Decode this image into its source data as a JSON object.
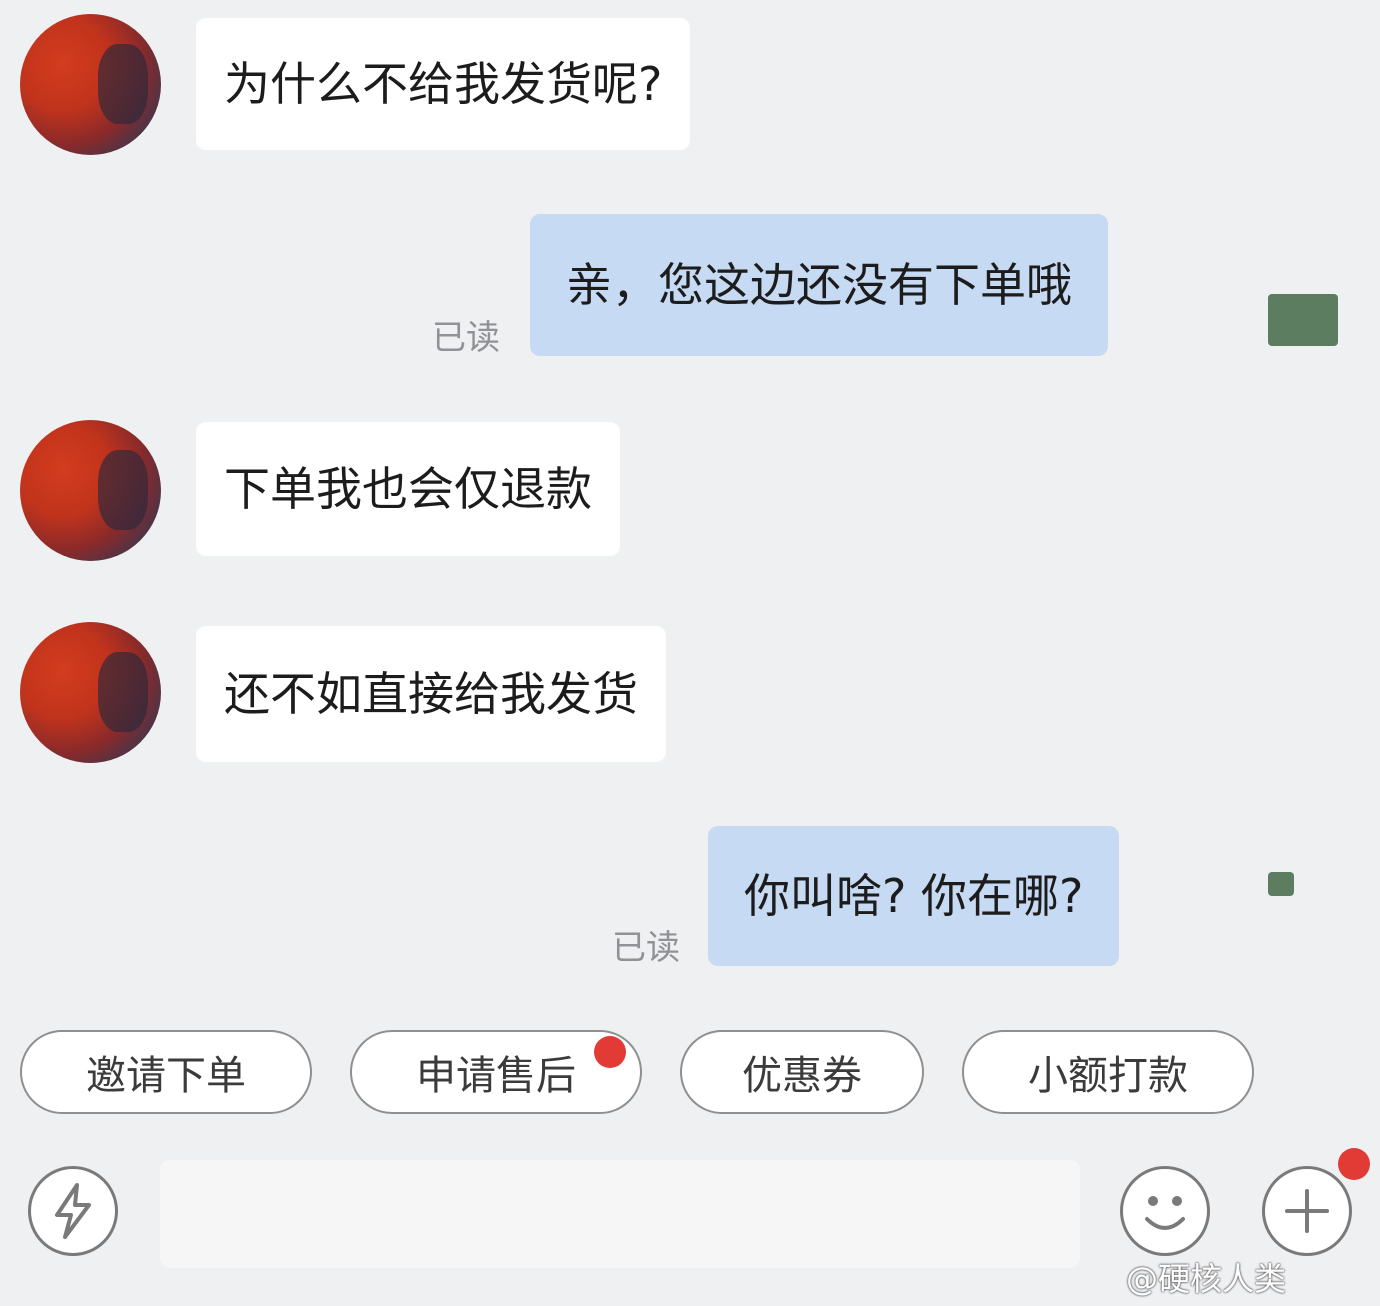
{
  "messages": {
    "m1": {
      "text": "为什么不给我发货呢?"
    },
    "m2": {
      "text": "亲，您这边还没有下单哦",
      "read": "已读"
    },
    "m3": {
      "text": "下单我也会仅退款"
    },
    "m4": {
      "text": "还不如直接给我发货"
    },
    "m5": {
      "text": "你叫啥? 你在哪?",
      "read": "已读"
    }
  },
  "quick_actions": [
    {
      "label": "邀请下单"
    },
    {
      "label": "申请售后",
      "has_badge": true
    },
    {
      "label": "优惠券"
    },
    {
      "label": "小额打款"
    }
  ],
  "toolbar": {
    "left_icon": "lightning-icon",
    "emoji_icon": "smiley-icon",
    "plus_icon": "plus-icon",
    "plus_has_badge": true
  },
  "watermark": "@硬核人类",
  "colors": {
    "background": "#eff0f2",
    "incoming_bubble": "#ffffff",
    "outgoing_bubble": "#c6daf3",
    "badge": "#e23b35"
  }
}
